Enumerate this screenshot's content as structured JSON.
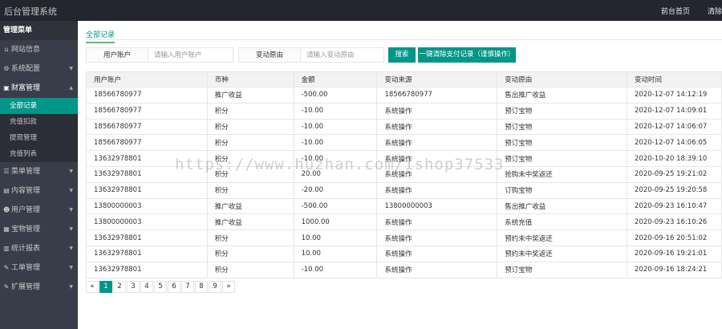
{
  "header": {
    "app_title": "后台管理系统",
    "links": [
      "前台首页",
      "清除"
    ]
  },
  "sidebar": {
    "title": "管理菜单",
    "groups": [
      {
        "label": "网站信息",
        "icon": "home-icon"
      },
      {
        "label": "系统配置",
        "icon": "gears-icon",
        "arrow": true
      },
      {
        "label": "财富管理",
        "icon": "money-icon",
        "arrow": true,
        "open": true,
        "children": [
          "全部记录",
          "充值扣款",
          "提现管理",
          "充值列表"
        ],
        "active_child": 0
      },
      {
        "label": "菜单管理",
        "icon": "list-icon",
        "arrow": true
      },
      {
        "label": "内容管理",
        "icon": "file-icon",
        "arrow": true
      },
      {
        "label": "用户管理",
        "icon": "users-icon",
        "arrow": true
      },
      {
        "label": "宝物管理",
        "icon": "gift-icon",
        "arrow": true
      },
      {
        "label": "统计报表",
        "icon": "chart-icon",
        "arrow": true
      },
      {
        "label": "工单管理",
        "icon": "wrench-icon",
        "arrow": true
      },
      {
        "label": "扩展管理",
        "icon": "tool-icon",
        "arrow": true
      }
    ]
  },
  "main": {
    "tab": "全部记录",
    "search": {
      "account_label": "用户账户",
      "account_placeholder": "请输入用户账户",
      "reason_label": "变动原由",
      "reason_placeholder": "请输入变动原由",
      "search_button": "搜索",
      "clear_button": "一键清除支付记录（谨慎操作）"
    },
    "table": {
      "columns": [
        "用户账户",
        "币种",
        "金额",
        "变动来源",
        "变动原由",
        "变动时间"
      ],
      "rows": [
        [
          "18566780977",
          "推广收益",
          "-500.00",
          "18566780977",
          "售出推广收益",
          "2020-12-07 14:12:19"
        ],
        [
          "18566780977",
          "积分",
          "-10.00",
          "系统操作",
          "预订宝物",
          "2020-12-07 14:09:01"
        ],
        [
          "18566780977",
          "积分",
          "-10.00",
          "系统操作",
          "预订宝物",
          "2020-12-07 14:06:07"
        ],
        [
          "18566780977",
          "积分",
          "-10.00",
          "系统操作",
          "预订宝物",
          "2020-12-07 14:06:05"
        ],
        [
          "13632978801",
          "积分",
          "-10.00",
          "系统操作",
          "预订宝物",
          "2020-10-20 18:39:10"
        ],
        [
          "13632978801",
          "积分",
          "20.00",
          "系统操作",
          "抢购未中奖返还",
          "2020-09-25 19:21:02"
        ],
        [
          "13632978801",
          "积分",
          "-20.00",
          "系统操作",
          "订购宝物",
          "2020-09-25 19:20:58"
        ],
        [
          "13800000003",
          "推广收益",
          "-500.00",
          "13800000003",
          "售出推广收益",
          "2020-09-23 16:10:47"
        ],
        [
          "13800000003",
          "推广收益",
          "1000.00",
          "系统操作",
          "系统充值",
          "2020-09-23 16:10:26"
        ],
        [
          "13632978801",
          "积分",
          "10.00",
          "系统操作",
          "预约未中奖返还",
          "2020-09-16 20:51:02"
        ],
        [
          "13632978801",
          "积分",
          "10.00",
          "系统操作",
          "预约未中奖返还",
          "2020-09-16 19:21:01"
        ],
        [
          "13632978801",
          "积分",
          "-10.00",
          "系统操作",
          "预订宝物",
          "2020-09-16 18:24:21"
        ]
      ]
    },
    "pagination": {
      "prev": "«",
      "pages": [
        "1",
        "2",
        "3",
        "4",
        "5",
        "6",
        "7",
        "8",
        "9"
      ],
      "current": "1",
      "next": "»"
    }
  },
  "watermark": "https://www.huzhan.com/ishop37533",
  "colors": {
    "accent": "#009688",
    "sidebar_bg": "#393d49",
    "topbar_bg": "#23262e"
  }
}
